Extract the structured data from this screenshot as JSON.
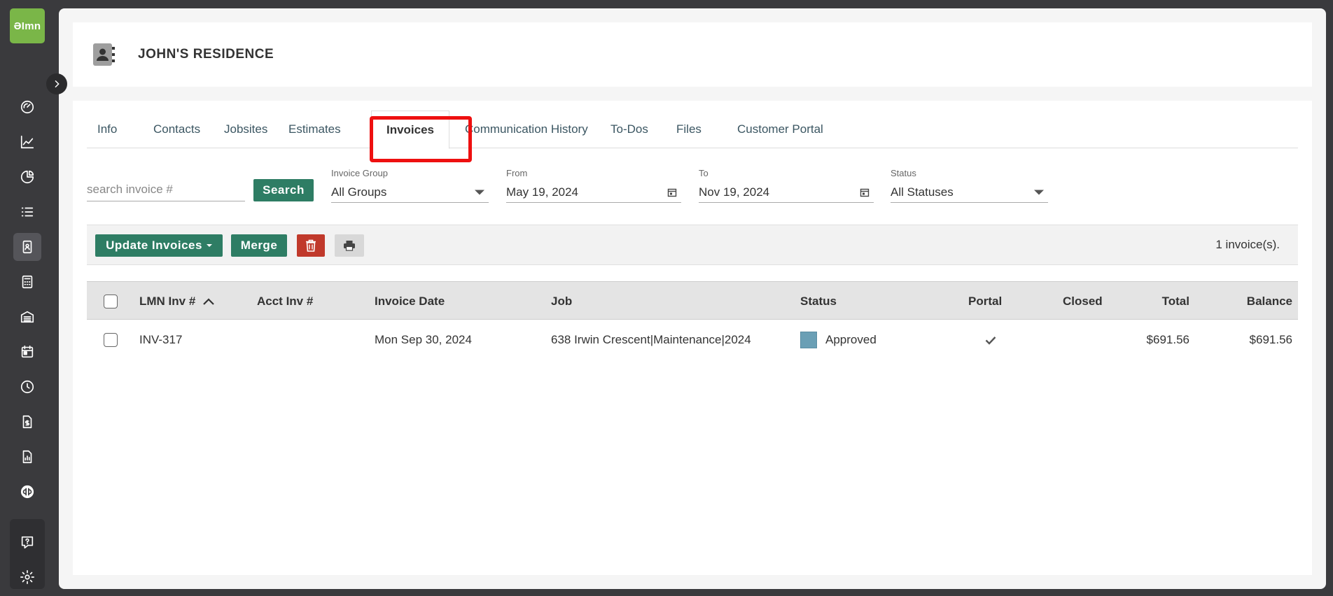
{
  "app": {
    "logo_text": "ƏImn"
  },
  "sidebar": {
    "icons": [
      "dashboard-icon",
      "chart-line-icon",
      "pie-chart-icon",
      "list-icon",
      "contacts-icon",
      "calculator-icon",
      "warehouse-icon",
      "calendar-icon",
      "clock-icon",
      "invoice-icon",
      "report-icon",
      "quickbooks-icon",
      "help-icon",
      "settings-icon"
    ]
  },
  "header": {
    "title": "JOHN'S RESIDENCE"
  },
  "tabs": [
    {
      "label": "Info",
      "active": false
    },
    {
      "label": "Contacts",
      "active": false
    },
    {
      "label": "Jobsites",
      "active": false
    },
    {
      "label": "Estimates",
      "active": false
    },
    {
      "label": "Invoices",
      "active": true
    },
    {
      "label": "Communication History",
      "active": false
    },
    {
      "label": "To-Dos",
      "active": false
    },
    {
      "label": "Files",
      "active": false
    },
    {
      "label": "Customer Portal",
      "active": false
    }
  ],
  "filters": {
    "search_placeholder": "search invoice #",
    "search_label": "Search",
    "group": {
      "label": "Invoice Group",
      "value": "All Groups"
    },
    "from": {
      "label": "From",
      "value": "May 19, 2024"
    },
    "to": {
      "label": "To",
      "value": "Nov 19, 2024"
    },
    "status": {
      "label": "Status",
      "value": "All Statuses"
    }
  },
  "toolbar": {
    "update_label": "Update Invoices",
    "merge_label": "Merge",
    "count_text": "1 invoice(s)."
  },
  "table": {
    "columns": {
      "lmn": "LMN Inv #",
      "acct": "Acct Inv #",
      "date": "Invoice Date",
      "job": "Job",
      "status": "Status",
      "portal": "Portal",
      "closed": "Closed",
      "total": "Total",
      "balance": "Balance"
    },
    "rows": [
      {
        "lmn": "INV-317",
        "acct": "",
        "date": "Mon Sep 30, 2024",
        "job": "638 Irwin Crescent|Maintenance|2024",
        "status": "Approved",
        "status_color": "#6a9fb5",
        "portal": "✓",
        "closed": "",
        "total": "$691.56",
        "balance": "$691.56"
      }
    ]
  },
  "colors": {
    "accent": "#2e7d64",
    "delete": "#c0392b",
    "highlight": "#ee1010",
    "brand": "#7ab648"
  }
}
